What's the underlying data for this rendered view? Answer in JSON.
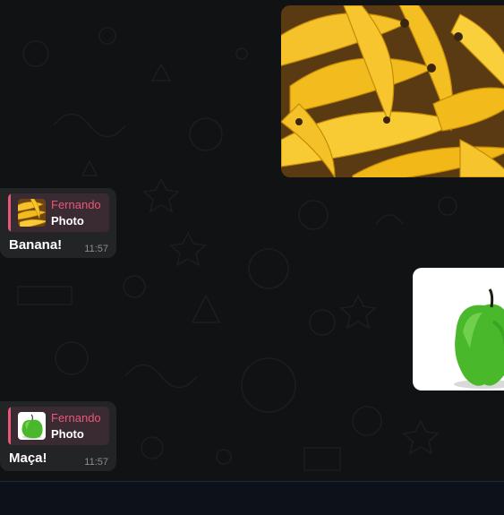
{
  "messages": [
    {
      "kind": "image",
      "image": "bananas-photo",
      "direction": "outgoing"
    },
    {
      "kind": "reply",
      "direction": "incoming",
      "quote": {
        "author": "Fernando",
        "type": "Photo",
        "thumb": "bananas-thumb"
      },
      "text": "Banana!",
      "time": "11:57"
    },
    {
      "kind": "image",
      "image": "green-apple-photo",
      "direction": "outgoing"
    },
    {
      "kind": "reply",
      "direction": "incoming",
      "quote": {
        "author": "Fernando",
        "type": "Photo",
        "thumb": "green-apple-thumb"
      },
      "text": "Maça!",
      "time": "11:57"
    }
  ],
  "colors": {
    "background": "#111213",
    "bubble_incoming": "#232425",
    "quote_accent": "#e8587a",
    "footer": "#0d111a"
  }
}
